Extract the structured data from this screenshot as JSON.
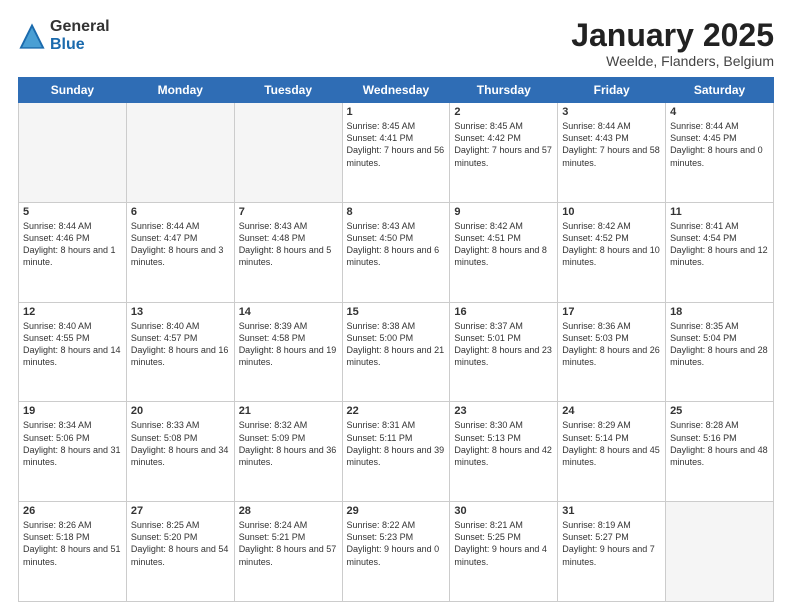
{
  "header": {
    "logo_general": "General",
    "logo_blue": "Blue",
    "month_title": "January 2025",
    "subtitle": "Weelde, Flanders, Belgium"
  },
  "days_of_week": [
    "Sunday",
    "Monday",
    "Tuesday",
    "Wednesday",
    "Thursday",
    "Friday",
    "Saturday"
  ],
  "weeks": [
    [
      {
        "day": "",
        "content": "",
        "empty": true
      },
      {
        "day": "",
        "content": "",
        "empty": true
      },
      {
        "day": "",
        "content": "",
        "empty": true
      },
      {
        "day": "1",
        "content": "Sunrise: 8:45 AM\nSunset: 4:41 PM\nDaylight: 7 hours\nand 56 minutes."
      },
      {
        "day": "2",
        "content": "Sunrise: 8:45 AM\nSunset: 4:42 PM\nDaylight: 7 hours\nand 57 minutes."
      },
      {
        "day": "3",
        "content": "Sunrise: 8:44 AM\nSunset: 4:43 PM\nDaylight: 7 hours\nand 58 minutes."
      },
      {
        "day": "4",
        "content": "Sunrise: 8:44 AM\nSunset: 4:45 PM\nDaylight: 8 hours\nand 0 minutes."
      }
    ],
    [
      {
        "day": "5",
        "content": "Sunrise: 8:44 AM\nSunset: 4:46 PM\nDaylight: 8 hours\nand 1 minute."
      },
      {
        "day": "6",
        "content": "Sunrise: 8:44 AM\nSunset: 4:47 PM\nDaylight: 8 hours\nand 3 minutes."
      },
      {
        "day": "7",
        "content": "Sunrise: 8:43 AM\nSunset: 4:48 PM\nDaylight: 8 hours\nand 5 minutes."
      },
      {
        "day": "8",
        "content": "Sunrise: 8:43 AM\nSunset: 4:50 PM\nDaylight: 8 hours\nand 6 minutes."
      },
      {
        "day": "9",
        "content": "Sunrise: 8:42 AM\nSunset: 4:51 PM\nDaylight: 8 hours\nand 8 minutes."
      },
      {
        "day": "10",
        "content": "Sunrise: 8:42 AM\nSunset: 4:52 PM\nDaylight: 8 hours\nand 10 minutes."
      },
      {
        "day": "11",
        "content": "Sunrise: 8:41 AM\nSunset: 4:54 PM\nDaylight: 8 hours\nand 12 minutes."
      }
    ],
    [
      {
        "day": "12",
        "content": "Sunrise: 8:40 AM\nSunset: 4:55 PM\nDaylight: 8 hours\nand 14 minutes."
      },
      {
        "day": "13",
        "content": "Sunrise: 8:40 AM\nSunset: 4:57 PM\nDaylight: 8 hours\nand 16 minutes."
      },
      {
        "day": "14",
        "content": "Sunrise: 8:39 AM\nSunset: 4:58 PM\nDaylight: 8 hours\nand 19 minutes."
      },
      {
        "day": "15",
        "content": "Sunrise: 8:38 AM\nSunset: 5:00 PM\nDaylight: 8 hours\nand 21 minutes."
      },
      {
        "day": "16",
        "content": "Sunrise: 8:37 AM\nSunset: 5:01 PM\nDaylight: 8 hours\nand 23 minutes."
      },
      {
        "day": "17",
        "content": "Sunrise: 8:36 AM\nSunset: 5:03 PM\nDaylight: 8 hours\nand 26 minutes."
      },
      {
        "day": "18",
        "content": "Sunrise: 8:35 AM\nSunset: 5:04 PM\nDaylight: 8 hours\nand 28 minutes."
      }
    ],
    [
      {
        "day": "19",
        "content": "Sunrise: 8:34 AM\nSunset: 5:06 PM\nDaylight: 8 hours\nand 31 minutes."
      },
      {
        "day": "20",
        "content": "Sunrise: 8:33 AM\nSunset: 5:08 PM\nDaylight: 8 hours\nand 34 minutes."
      },
      {
        "day": "21",
        "content": "Sunrise: 8:32 AM\nSunset: 5:09 PM\nDaylight: 8 hours\nand 36 minutes."
      },
      {
        "day": "22",
        "content": "Sunrise: 8:31 AM\nSunset: 5:11 PM\nDaylight: 8 hours\nand 39 minutes."
      },
      {
        "day": "23",
        "content": "Sunrise: 8:30 AM\nSunset: 5:13 PM\nDaylight: 8 hours\nand 42 minutes."
      },
      {
        "day": "24",
        "content": "Sunrise: 8:29 AM\nSunset: 5:14 PM\nDaylight: 8 hours\nand 45 minutes."
      },
      {
        "day": "25",
        "content": "Sunrise: 8:28 AM\nSunset: 5:16 PM\nDaylight: 8 hours\nand 48 minutes."
      }
    ],
    [
      {
        "day": "26",
        "content": "Sunrise: 8:26 AM\nSunset: 5:18 PM\nDaylight: 8 hours\nand 51 minutes."
      },
      {
        "day": "27",
        "content": "Sunrise: 8:25 AM\nSunset: 5:20 PM\nDaylight: 8 hours\nand 54 minutes."
      },
      {
        "day": "28",
        "content": "Sunrise: 8:24 AM\nSunset: 5:21 PM\nDaylight: 8 hours\nand 57 minutes."
      },
      {
        "day": "29",
        "content": "Sunrise: 8:22 AM\nSunset: 5:23 PM\nDaylight: 9 hours\nand 0 minutes."
      },
      {
        "day": "30",
        "content": "Sunrise: 8:21 AM\nSunset: 5:25 PM\nDaylight: 9 hours\nand 4 minutes."
      },
      {
        "day": "31",
        "content": "Sunrise: 8:19 AM\nSunset: 5:27 PM\nDaylight: 9 hours\nand 7 minutes."
      },
      {
        "day": "",
        "content": "",
        "empty": true
      }
    ]
  ]
}
